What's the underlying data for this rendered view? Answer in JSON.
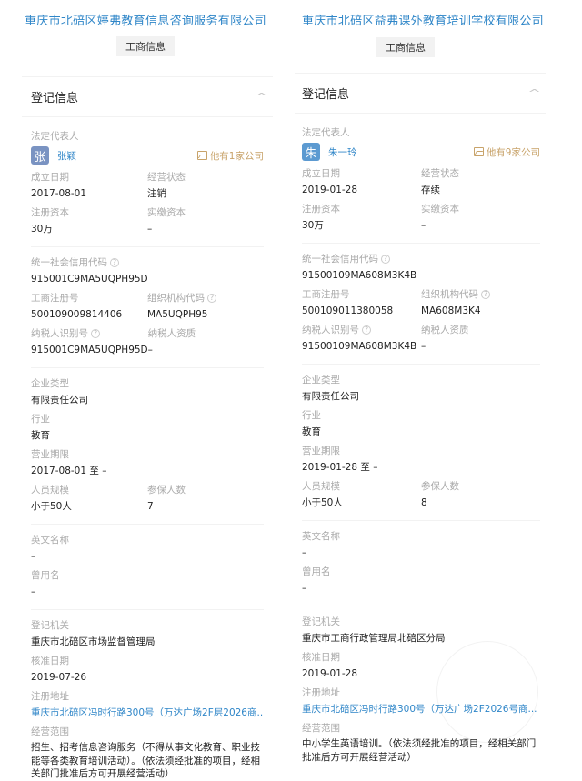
{
  "companies": [
    {
      "name": "重庆市北碚区婷弗教育信息咨询服务有限公司",
      "tab_label": "工商信息",
      "section_title": "登记信息",
      "legal_rep_label": "法定代表人",
      "legal_rep_avatar": "张",
      "legal_rep_name": "张颖",
      "other_companies": "他有1家公司",
      "founded_label": "成立日期",
      "founded": "2017-08-01",
      "status_label": "经营状态",
      "status": "注销",
      "reg_capital_label": "注册资本",
      "reg_capital": "30万",
      "paid_capital_label": "实缴资本",
      "paid_capital": "–",
      "credit_code_label": "统一社会信用代码",
      "credit_code": "915001C9MA5UQPH95D",
      "reg_no_label": "工商注册号",
      "reg_no": "500109009814406",
      "org_code_label": "组织机构代码",
      "org_code": "MA5UQPH95",
      "taxpayer_id_label": "纳税人识别号",
      "taxpayer_id": "915001C9MA5UQPH95D",
      "taxpayer_qual_label": "纳税人资质",
      "taxpayer_qual": "–",
      "company_type_label": "企业类型",
      "company_type": "有限责任公司",
      "industry_label": "行业",
      "industry": "教育",
      "term_label": "营业期限",
      "term": "2017-08-01 至 –",
      "staff_size_label": "人员规模",
      "staff_size": "小于50人",
      "insured_label": "参保人数",
      "insured": "7",
      "english_name_label": "英文名称",
      "english_name": "–",
      "former_name_label": "曾用名",
      "former_name": "–",
      "authority_label": "登记机关",
      "authority": "重庆市北碚区市场监督管理局",
      "approval_date_label": "核准日期",
      "approval_date": "2019-07-26",
      "address_label": "注册地址",
      "address": "重庆市北碚区冯时行路300号（万达广场2F层2026商...",
      "scope_label": "经营范围",
      "scope": "招生、招考信息咨询服务（不得从事文化教育、职业技能等各类教育培训活动）。（依法须经批准的项目，经相关部门批准后方可开展经营活动）"
    },
    {
      "name": "重庆市北碚区益弗课外教育培训学校有限公司",
      "tab_label": "工商信息",
      "section_title": "登记信息",
      "legal_rep_label": "法定代表人",
      "legal_rep_avatar": "朱",
      "legal_rep_name": "朱一玲",
      "other_companies": "他有9家公司",
      "founded_label": "成立日期",
      "founded": "2019-01-28",
      "status_label": "经营状态",
      "status": "存续",
      "reg_capital_label": "注册资本",
      "reg_capital": "30万",
      "paid_capital_label": "实缴资本",
      "paid_capital": "–",
      "credit_code_label": "统一社会信用代码",
      "credit_code": "91500109MA608M3K4B",
      "reg_no_label": "工商注册号",
      "reg_no": "500109011380058",
      "org_code_label": "组织机构代码",
      "org_code": "MA608M3K4",
      "taxpayer_id_label": "纳税人识别号",
      "taxpayer_id": "91500109MA608M3K4B",
      "taxpayer_qual_label": "纳税人资质",
      "taxpayer_qual": "–",
      "company_type_label": "企业类型",
      "company_type": "有限责任公司",
      "industry_label": "行业",
      "industry": "教育",
      "term_label": "营业期限",
      "term": "2019-01-28 至 –",
      "staff_size_label": "人员规模",
      "staff_size": "小于50人",
      "insured_label": "参保人数",
      "insured": "8",
      "english_name_label": "英文名称",
      "english_name": "–",
      "former_name_label": "曾用名",
      "former_name": "–",
      "authority_label": "登记机关",
      "authority": "重庆市工商行政管理局北碚区分局",
      "approval_date_label": "核准日期",
      "approval_date": "2019-01-28",
      "address_label": "注册地址",
      "address": "重庆市北碚区冯时行路300号（万达广场2F2026号商...",
      "scope_label": "经营范围",
      "scope": "中小学生英语培训。（依法须经批准的项目，经相关部门批准后方可开展经营活动）"
    }
  ],
  "icons": {
    "help": "?",
    "collapse": "^"
  }
}
